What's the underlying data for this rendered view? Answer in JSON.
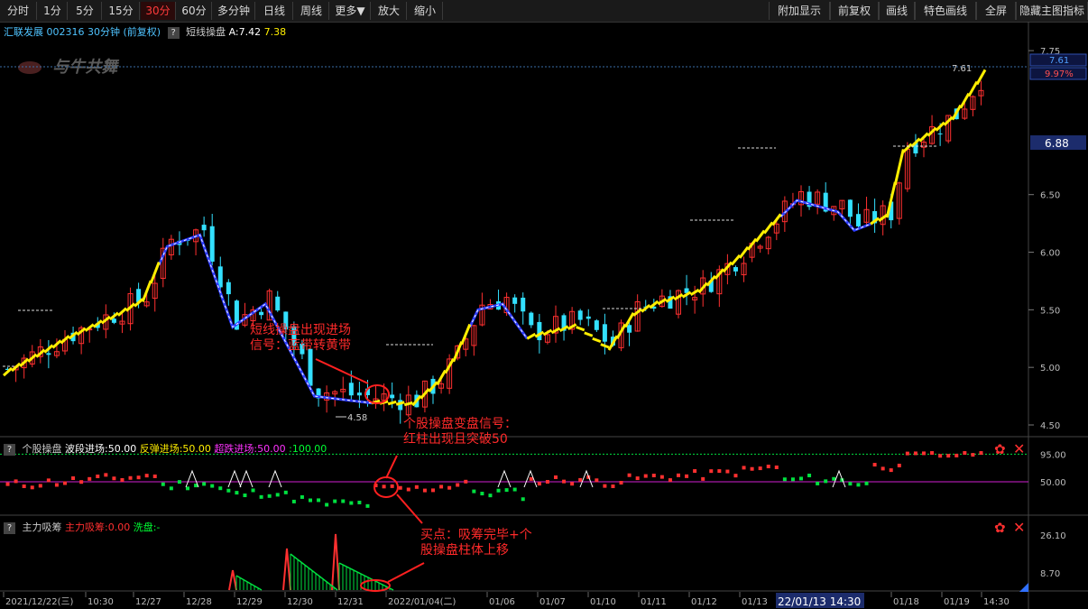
{
  "toolbar": {
    "left": [
      "分时",
      "1分",
      "5分",
      "15分",
      "30分",
      "60分",
      "多分钟",
      "日线",
      "周线",
      "更多▼",
      "放大",
      "缩小"
    ],
    "active": "30分",
    "right": [
      "附加显示",
      "前复权",
      "画线",
      "特色画线",
      "全屏",
      "隐藏主图指标"
    ]
  },
  "header": {
    "stock": "汇联发展",
    "code": "002316",
    "period": "30分钟",
    "adjust": "(前复权)",
    "qmark": "?",
    "indicator": "短线操盘",
    "a_value": "A:7.42",
    "b_value": "7.38"
  },
  "watermark": "与牛共舞",
  "price_axis": {
    "ticks": [
      "7.75",
      "6.50",
      "6.00",
      "5.50",
      "5.00",
      "4.50"
    ],
    "ticks_values": [
      7.75,
      6.5,
      6.0,
      5.5,
      5.0,
      4.5
    ],
    "current_price": "7.61",
    "current_pct": "9.97%",
    "cursor_price": "6.88",
    "peak_label": "7.61",
    "low_label": "4.58"
  },
  "panel2": {
    "qmark": "?",
    "name": "个股操盘",
    "l1": "波段进场:50.00",
    "l2": "反弹进场:50.00",
    "l3": "超跌进场:50.00",
    "l4": ":100.00",
    "ticks": [
      "95.00",
      "50.00"
    ]
  },
  "panel3": {
    "qmark": "?",
    "name": "主力吸筹",
    "l1": "主力吸筹:0.00",
    "l2": "洗盘:-",
    "ticks": [
      "26.10",
      "8.70"
    ]
  },
  "time_axis": [
    "2021/12/22(三)",
    "10:30",
    "12/27",
    "12/28",
    "12/29",
    "12/30",
    "12/31",
    "2022/01/04(二)",
    "01/06",
    "01/07",
    "01/10",
    "01/11",
    "01/12",
    "01/13",
    "01/18",
    "01/19",
    "14:30"
  ],
  "time_cursor": "22/01/13 14:30",
  "annotations": {
    "a1": [
      "短线操盘出现进场",
      "信号：蓝带转黄带"
    ],
    "a2": [
      "个股操盘变盘信号：",
      "红柱出现且突破50"
    ],
    "a3": [
      "买点：吸筹完毕+个",
      "股操盘柱体上移"
    ]
  },
  "colors": {
    "up": "#ff3030",
    "down": "#33e0ff",
    "line_up": "#ffee00",
    "line_down": "#2d3cff",
    "purple": "#d020d0",
    "green": "#00e040"
  },
  "chart_data": {
    "type": "candlestick",
    "title": "",
    "ylim": [
      4.5,
      7.75
    ],
    "bar_count": 120,
    "close_keypoints": [
      [
        0,
        4.98
      ],
      [
        8,
        5.3
      ],
      [
        14,
        5.5
      ],
      [
        17,
        5.62
      ],
      [
        20,
        6.1
      ],
      [
        24,
        6.2
      ],
      [
        28,
        5.4
      ],
      [
        32,
        5.6
      ],
      [
        38,
        4.8
      ],
      [
        45,
        4.74
      ],
      [
        50,
        4.72
      ],
      [
        53,
        4.9
      ],
      [
        55,
        5.1
      ],
      [
        58,
        5.55
      ],
      [
        61,
        5.6
      ],
      [
        64,
        5.3
      ],
      [
        70,
        5.4
      ],
      [
        74,
        5.2
      ],
      [
        77,
        5.5
      ],
      [
        80,
        5.6
      ],
      [
        85,
        5.7
      ],
      [
        90,
        6.0
      ],
      [
        97,
        6.5
      ],
      [
        102,
        6.4
      ],
      [
        104,
        6.24
      ],
      [
        108,
        6.35
      ],
      [
        110,
        6.92
      ],
      [
        116,
        7.2
      ],
      [
        120,
        7.61
      ]
    ],
    "yellow_line_ranges": [
      [
        0,
        19
      ],
      [
        45,
        57
      ],
      [
        64,
        95
      ],
      [
        106,
        120
      ]
    ],
    "blue_line_ranges": [
      [
        19,
        45
      ],
      [
        57,
        64
      ],
      [
        95,
        106
      ]
    ]
  }
}
